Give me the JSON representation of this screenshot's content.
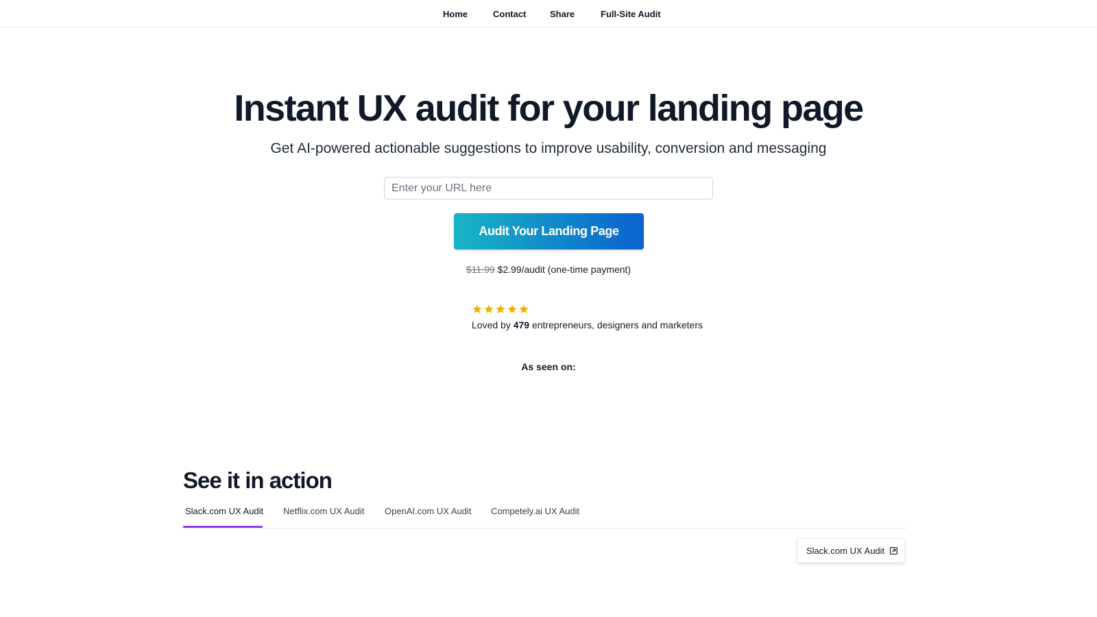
{
  "nav": {
    "items": [
      {
        "label": "Home"
      },
      {
        "label": "Contact"
      },
      {
        "label": "Share"
      },
      {
        "label": "Full-Site Audit"
      }
    ]
  },
  "hero": {
    "title": "Instant UX audit for your landing page",
    "subtitle": "Get AI-powered actionable suggestions to improve usability, conversion and messaging",
    "url_input": {
      "value": "",
      "placeholder": "Enter your URL here"
    },
    "cta_label": "Audit Your Landing Page",
    "cta_colors": {
      "from": "#17b5c4",
      "to": "#0b62d0"
    },
    "price": {
      "old": "$11.99",
      "current": "$2.99/audit (one-time payment)"
    }
  },
  "social_proof": {
    "rating": 5,
    "rating_max": 5,
    "star_icon": "star-icon",
    "star_color": "#eab308",
    "loved_prefix": "Loved by",
    "loved_count": "479",
    "loved_suffix": "entrepreneurs, designers and marketers",
    "seen_on_label": "As seen on:"
  },
  "demo": {
    "title": "See it in action",
    "tabs": [
      {
        "label": "Slack.com UX Audit",
        "active": true
      },
      {
        "label": "Netflix.com UX Audit",
        "active": false
      },
      {
        "label": "OpenAI.com UX Audit",
        "active": false
      },
      {
        "label": "Competely.ai UX Audit",
        "active": false
      }
    ],
    "active_tab_color": "#8b3fe6",
    "card": {
      "label": "Slack.com UX Audit",
      "icon": "external-link-icon"
    }
  }
}
